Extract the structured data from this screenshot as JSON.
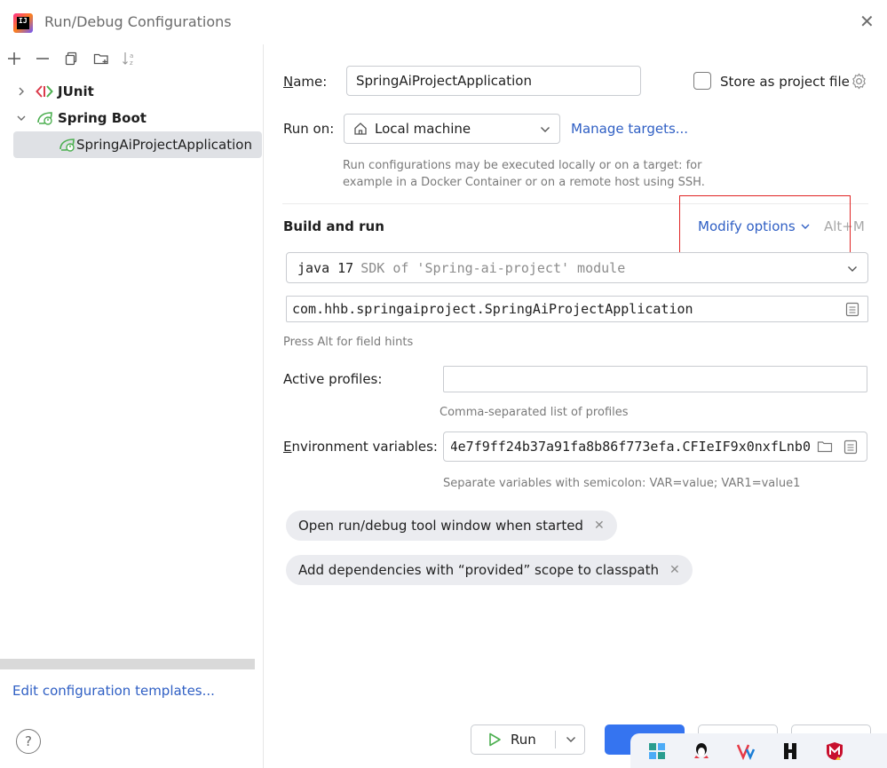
{
  "window": {
    "title": "Run/Debug Configurations",
    "app_icon_text": "IJ"
  },
  "tree": {
    "junit": "JUnit",
    "spring_boot": "Spring Boot",
    "app": "SpringAiProjectApplication"
  },
  "left_footer": {
    "edit_templates": "Edit configuration templates...",
    "help": "?"
  },
  "form": {
    "name_label_first": "N",
    "name_label_rest": "ame:",
    "name_value": "SpringAiProjectApplication",
    "store_label": "Store as project file",
    "run_on_label": "Run on:",
    "run_on_value": "Local machine",
    "manage_targets": "Manage targets...",
    "run_on_hint_1": "Run configurations may be executed locally or on a target: for",
    "run_on_hint_2": "example in a Docker Container or on a remote host using SSH.",
    "build_run": "Build and run",
    "modify_options": "Modify options",
    "modify_shortcut": "Alt+M",
    "sdk_main": "java 17",
    "sdk_sub": "SDK of 'Spring-ai-project' module",
    "main_class": "com.hhb.springaiproject.SpringAiProjectApplication",
    "alt_hint": "Press Alt for field hints",
    "profiles_label": "Active profiles:",
    "profiles_value": "",
    "profiles_hint": "Comma-separated list of profiles",
    "env_label_first": "E",
    "env_label_rest": "nvironment variables:",
    "env_value": "4e7f9ff24b37a91fa8b86f773efa.CFIeIF9x0nxfLnb0",
    "env_hint": "Separate variables with semicolon: VAR=value; VAR1=value1",
    "chip_1": "Open run/debug tool window when started",
    "chip_2": "Add dependencies with “provided” scope to classpath"
  },
  "footer": {
    "run": "Run"
  },
  "colors": {
    "accent": "#3574f0",
    "link": "#2f5fc4",
    "highlight_box": "#e02424",
    "selection": "#dfe1e5"
  }
}
